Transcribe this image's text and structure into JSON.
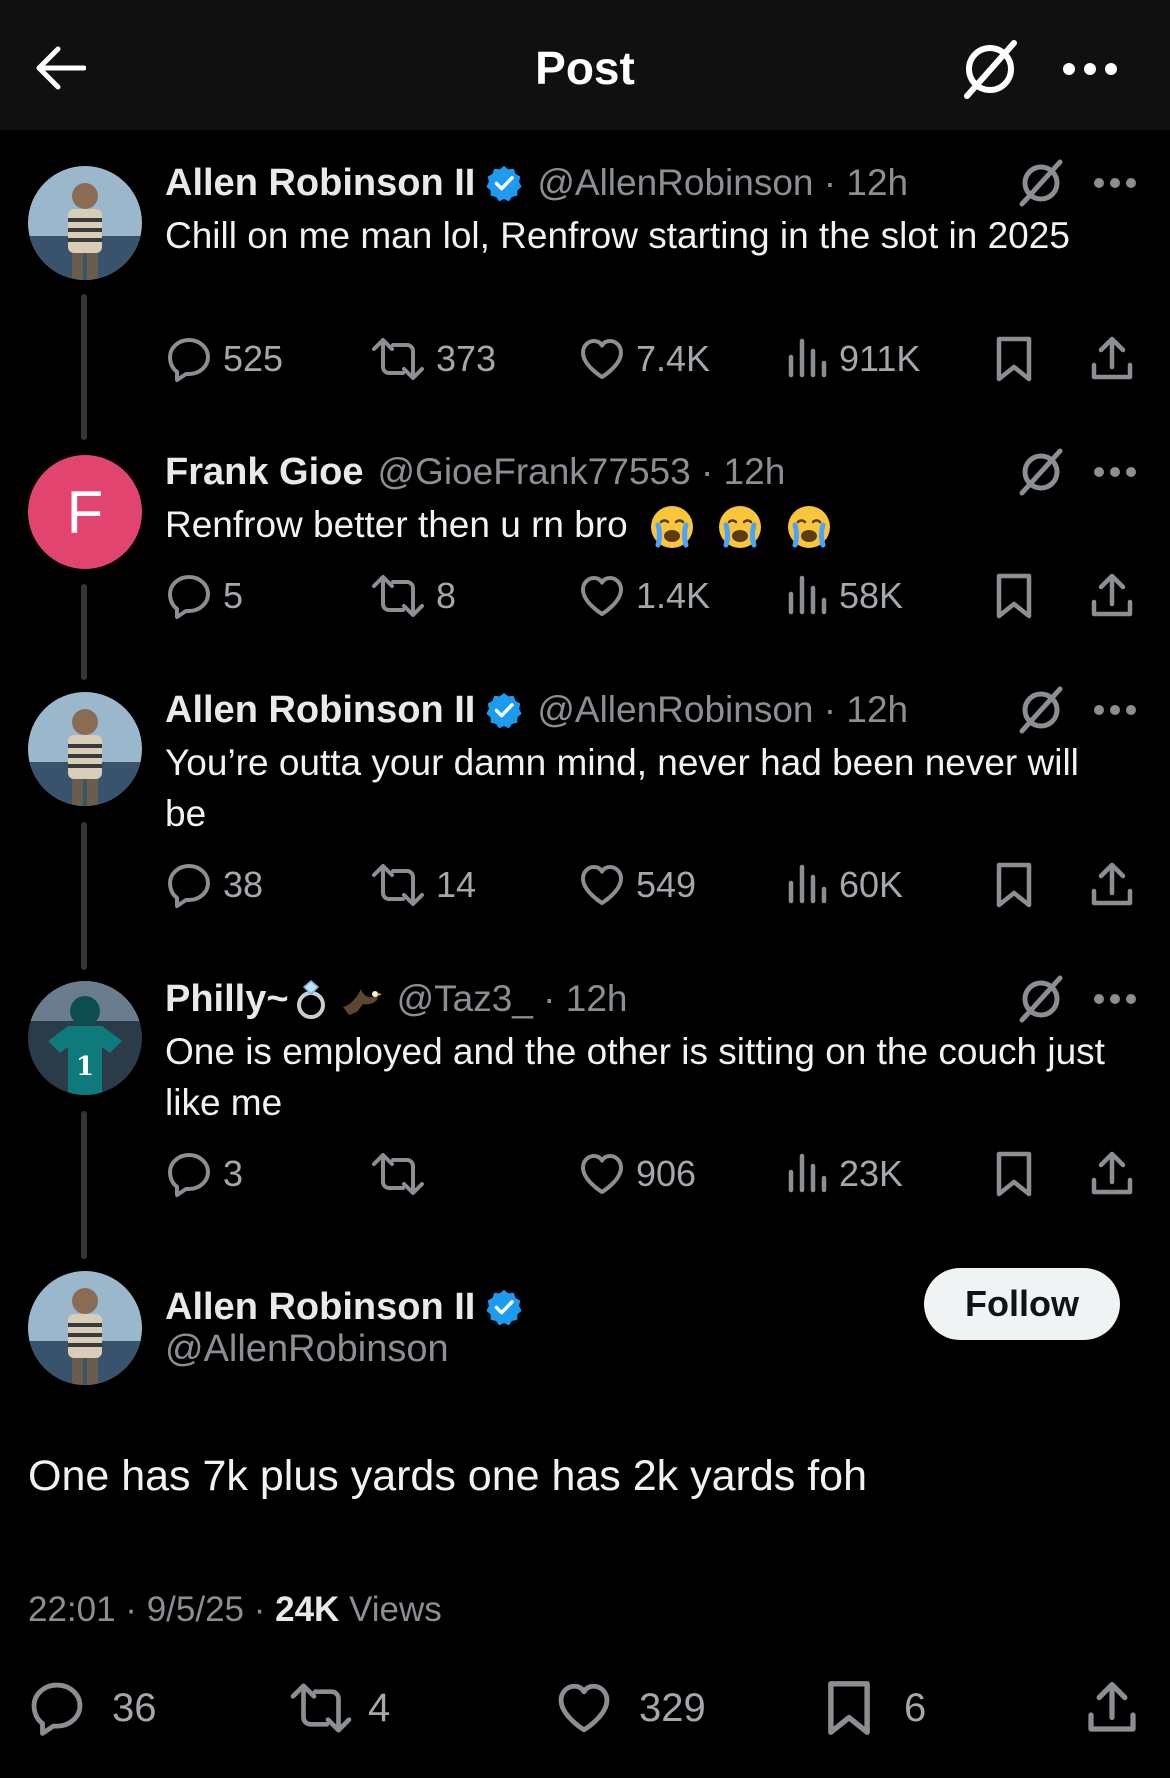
{
  "header": {
    "title": "Post"
  },
  "replies": [
    {
      "name": "Allen Robinson II",
      "verified": true,
      "handle": "@AllenRobinson · 12h",
      "text": "Chill on me man lol, Renfrow starting in the slot in 2025",
      "replies": "525",
      "reposts": "373",
      "likes": "7.4K",
      "views": "911K"
    },
    {
      "name": "Frank Gioe",
      "avatar_letter": "F",
      "verified": false,
      "handle": "@GioeFrank77553 · 12h",
      "text": "Renfrow better then u rn bro",
      "replies": "5",
      "reposts": "8",
      "likes": "1.4K",
      "views": "58K"
    },
    {
      "name": "Allen Robinson II",
      "verified": true,
      "handle": "@AllenRobinson · 12h",
      "text": "You’re outta your damn mind, never had been never will be",
      "replies": "38",
      "reposts": "14",
      "likes": "549",
      "views": "60K"
    },
    {
      "name": "Philly~",
      "verified": false,
      "handle": "@Taz3_ · 12h",
      "text": "One is employed and the other is sitting on the couch just like me",
      "replies": "3",
      "reposts": "",
      "likes": "906",
      "views": "23K"
    }
  ],
  "main_post": {
    "name": "Allen Robinson II",
    "handle": "@AllenRobinson",
    "follow_label": "Follow",
    "text": "One has 7k plus yards one has 2k yards foh",
    "timestamp": "22:01 · 9/5/25 · ",
    "views_count": "24K",
    "views_label": " Views",
    "replies": "36",
    "reposts": "4",
    "likes": "329",
    "bookmarks": "6"
  },
  "colors": {
    "background": "#000000",
    "verified": "#1d9bf0",
    "avatar_f": "#e0446f",
    "icon": "#8b8f93"
  }
}
